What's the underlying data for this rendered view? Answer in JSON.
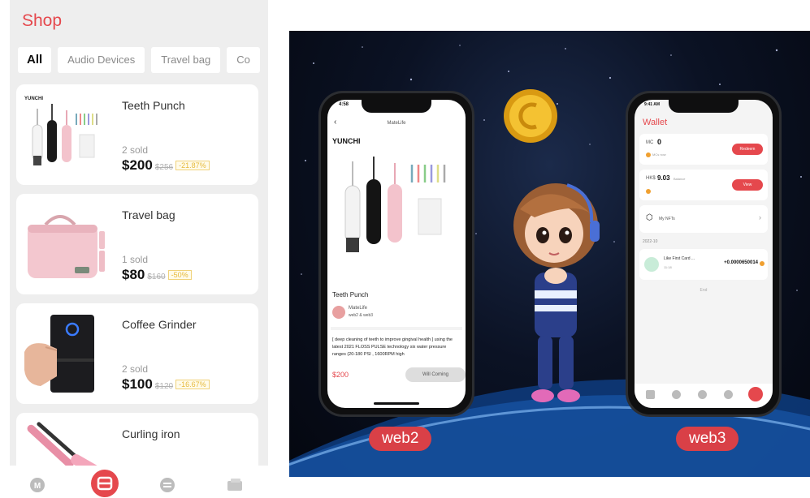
{
  "shop": {
    "title": "Shop",
    "tabs": [
      "All",
      "Audio Devices",
      "Travel bag",
      "Co"
    ],
    "products": [
      {
        "name": "Teeth Punch",
        "sold": "2 sold",
        "price": "$200",
        "old_price": "$256",
        "discount": "-21.87%"
      },
      {
        "name": "Travel bag",
        "sold": "1 sold",
        "price": "$80",
        "old_price": "$160",
        "discount": "-50%"
      },
      {
        "name": "Coffee Grinder",
        "sold": "2 sold",
        "price": "$100",
        "old_price": "$120",
        "discount": "-16.67%"
      },
      {
        "name": "Curling iron"
      }
    ],
    "nav_icons": [
      "m-icon",
      "shop-icon",
      "chat-icon",
      "card-icon"
    ]
  },
  "web2_phone": {
    "time": "4:58",
    "header_title": "MateLife",
    "brand": "YUNCHI",
    "product_title": "Teeth Punch",
    "seller_name": "MateLife",
    "seller_sub": "web2 & web3",
    "description": "[ deep cleaning of teeth to improve gingival health ] using the latest 2021 FLOSS PULSE technology six water pressure ranges (20-180 PSI , 1600RPM high",
    "price": "$200",
    "button": "Will Coming"
  },
  "web3_phone": {
    "time": "9:41 AM",
    "title": "Wallet",
    "mc_label": "MC",
    "mc_value": "0",
    "mc_sub": "MCs now",
    "redeem": "Redeem",
    "hks_label": "HK$",
    "hks_value": "9.03",
    "hks_sub": "Balance",
    "view": "View",
    "nfts": "My NFTs",
    "date": "2022-10",
    "tx_title": "Like First Card ...",
    "tx_time": "11:18",
    "tx_amount": "+0.0000650014",
    "end": "End"
  },
  "labels": {
    "web2": "web2",
    "web3": "web3"
  },
  "colors": {
    "accent": "#e5484d",
    "label_pill": "#d94047",
    "discount": "#e6b93a"
  }
}
